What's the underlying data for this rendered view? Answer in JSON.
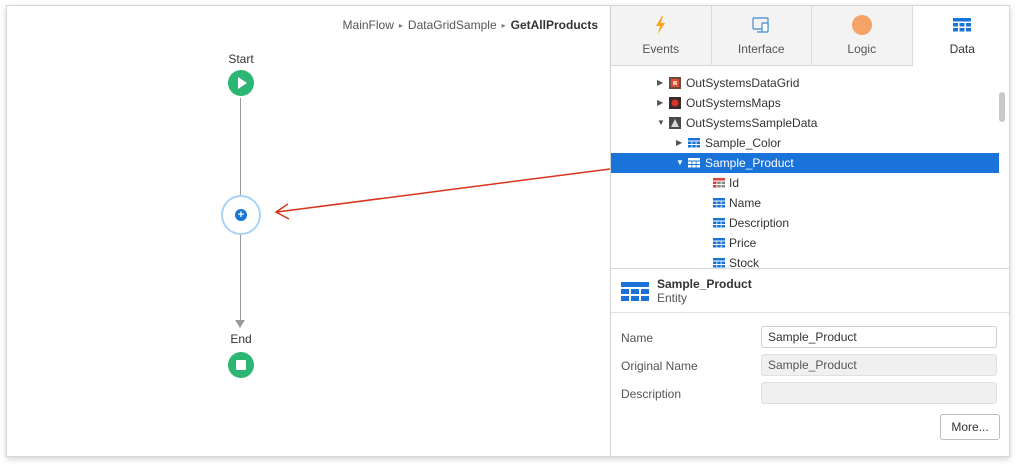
{
  "breadcrumb": {
    "items": [
      "MainFlow",
      "DataGridSample"
    ],
    "current": "GetAllProducts",
    "separator": "▸"
  },
  "flow": {
    "start_label": "Start",
    "end_label": "End",
    "add_symbol": "+"
  },
  "tabs": [
    {
      "label": "Events",
      "icon": "lightning-icon"
    },
    {
      "label": "Interface",
      "icon": "screen-icon"
    },
    {
      "label": "Logic",
      "icon": "circle-icon"
    },
    {
      "label": "Data",
      "icon": "grid-icon",
      "active": true
    }
  ],
  "tree": {
    "items": [
      {
        "label": "OutSystemsDataGrid",
        "expanded": false,
        "icon": "module-icon"
      },
      {
        "label": "OutSystemsMaps",
        "expanded": false,
        "icon": "module-icon"
      },
      {
        "label": "OutSystemsSampleData",
        "expanded": true,
        "icon": "module-icon"
      },
      {
        "label": "Sample_Color",
        "expanded": false,
        "icon": "entity-icon"
      },
      {
        "label": "Sample_Product",
        "expanded": true,
        "icon": "entity-icon",
        "selected": true
      },
      {
        "label": "Id",
        "icon": "id-attribute-icon"
      },
      {
        "label": "Name",
        "icon": "attribute-icon"
      },
      {
        "label": "Description",
        "icon": "attribute-icon"
      },
      {
        "label": "Price",
        "icon": "attribute-icon"
      },
      {
        "label": "Stock",
        "icon": "attribute-icon"
      }
    ]
  },
  "properties": {
    "title": "Sample_Product",
    "subtitle": "Entity",
    "fields": [
      {
        "label": "Name",
        "value": "Sample_Product",
        "readonly": false
      },
      {
        "label": "Original Name",
        "value": "Sample_Product",
        "readonly": true
      },
      {
        "label": "Description",
        "value": "",
        "readonly": true
      }
    ],
    "more_button": "More..."
  },
  "colors": {
    "accent": "#1a73d9",
    "flow_node": "#2bb673",
    "arrow": "#d9331a",
    "events_icon": "#f6a623",
    "logic_icon": "#f5a366"
  }
}
